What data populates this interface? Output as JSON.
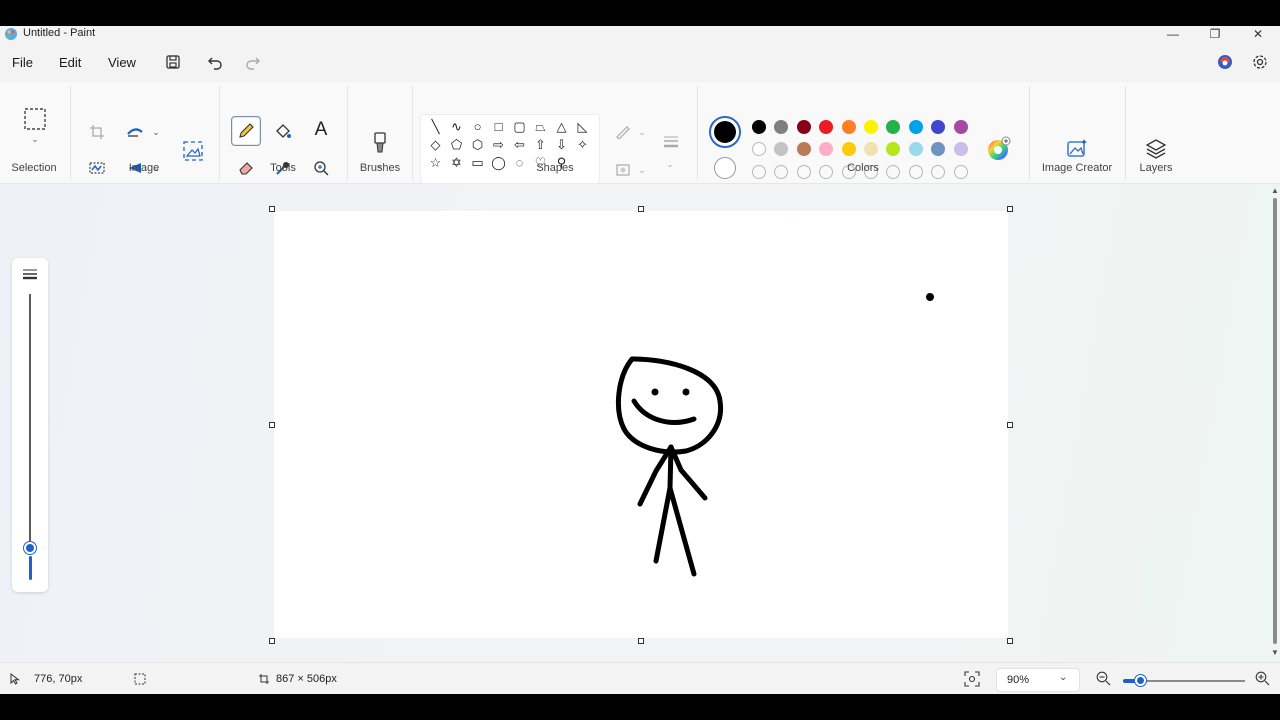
{
  "window": {
    "title": "Untitled - Paint",
    "minimize_glyph": "—",
    "restore_glyph": "❐",
    "close_glyph": "✕"
  },
  "menu": {
    "file": "File",
    "edit": "Edit",
    "view": "View"
  },
  "ribbon": {
    "groups": {
      "selection": "Selection",
      "image": "Image",
      "tools": "Tools",
      "brushes": "Brushes",
      "shapes": "Shapes",
      "colors": "Colors",
      "image_creator": "Image Creator",
      "layers": "Layers"
    },
    "text_tool_glyph": "A",
    "shape_glyphs": [
      [
        "╲",
        "∿",
        "○",
        "□",
        "▢",
        "⏢",
        "△",
        "◺"
      ],
      [
        "◇",
        "⬠",
        "⬡",
        "⇨",
        "⇦",
        "⇧",
        "⇩",
        "✧"
      ],
      [
        "☆",
        "✡",
        "▭",
        "◯",
        "◌",
        "♡",
        "⚲"
      ]
    ],
    "colors": {
      "primary": "#000000",
      "secondary": "#ffffff",
      "row1": [
        "#000000",
        "#7f7f7f",
        "#880015",
        "#ed1c24",
        "#ff7f27",
        "#fff200",
        "#22b14c",
        "#00a2e8",
        "#3f48cc",
        "#a349a4"
      ],
      "row2": [
        "#ffffff",
        "#c3c3c3",
        "#b97a57",
        "#ffaec9",
        "#ffc90e",
        "#efe4b0",
        "#b5e61d",
        "#99d9ea",
        "#7092be",
        "#c8bfe7"
      ],
      "row3_count": 10
    }
  },
  "status": {
    "cursor_position": "776, 70px",
    "canvas_size": "867 × 506px",
    "zoom": "90%"
  }
}
